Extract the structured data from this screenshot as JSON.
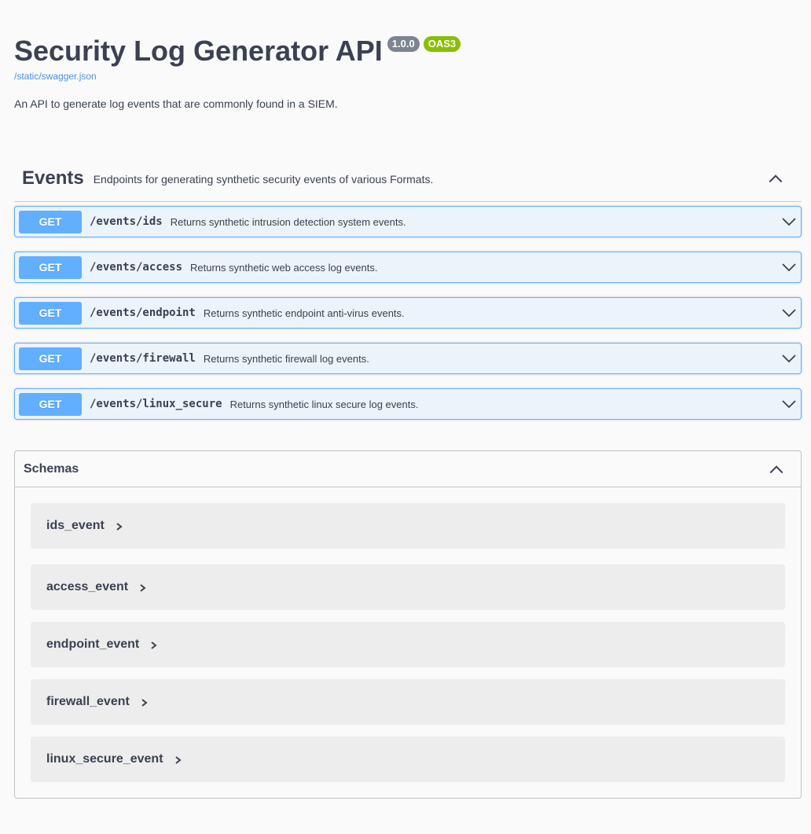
{
  "info": {
    "title": "Security Log Generator API",
    "version": "1.0.0",
    "oas": "OAS3",
    "spec_link": "/static/swagger.json",
    "description": "An API to generate log events that are commonly found in a SIEM."
  },
  "tag": {
    "name": "Events",
    "description": "Endpoints for generating synthetic security events of various Formats."
  },
  "operations": [
    {
      "method": "GET",
      "path": "/events/ids",
      "summary": "Returns synthetic intrusion detection system events."
    },
    {
      "method": "GET",
      "path": "/events/access",
      "summary": "Returns synthetic web access log events."
    },
    {
      "method": "GET",
      "path": "/events/endpoint",
      "summary": "Returns synthetic endpoint anti-virus events."
    },
    {
      "method": "GET",
      "path": "/events/firewall",
      "summary": "Returns synthetic firewall log events."
    },
    {
      "method": "GET",
      "path": "/events/linux_secure",
      "summary": "Returns synthetic linux secure log events."
    }
  ],
  "schemas": {
    "title": "Schemas",
    "models": [
      "ids_event",
      "access_event",
      "endpoint_event",
      "firewall_event",
      "linux_secure_event"
    ]
  },
  "colors": {
    "get_method": "#61affe",
    "get_background": "#ebf3fb",
    "version_badge": "#7d8492",
    "oas_badge": "#89bf04",
    "link": "#4990e2"
  },
  "icons": {
    "tag_toggle": "chevron-up-icon",
    "operation_toggle": "chevron-down-icon",
    "schemas_toggle": "chevron-up-icon",
    "model_expand": "chevron-right-icon"
  }
}
